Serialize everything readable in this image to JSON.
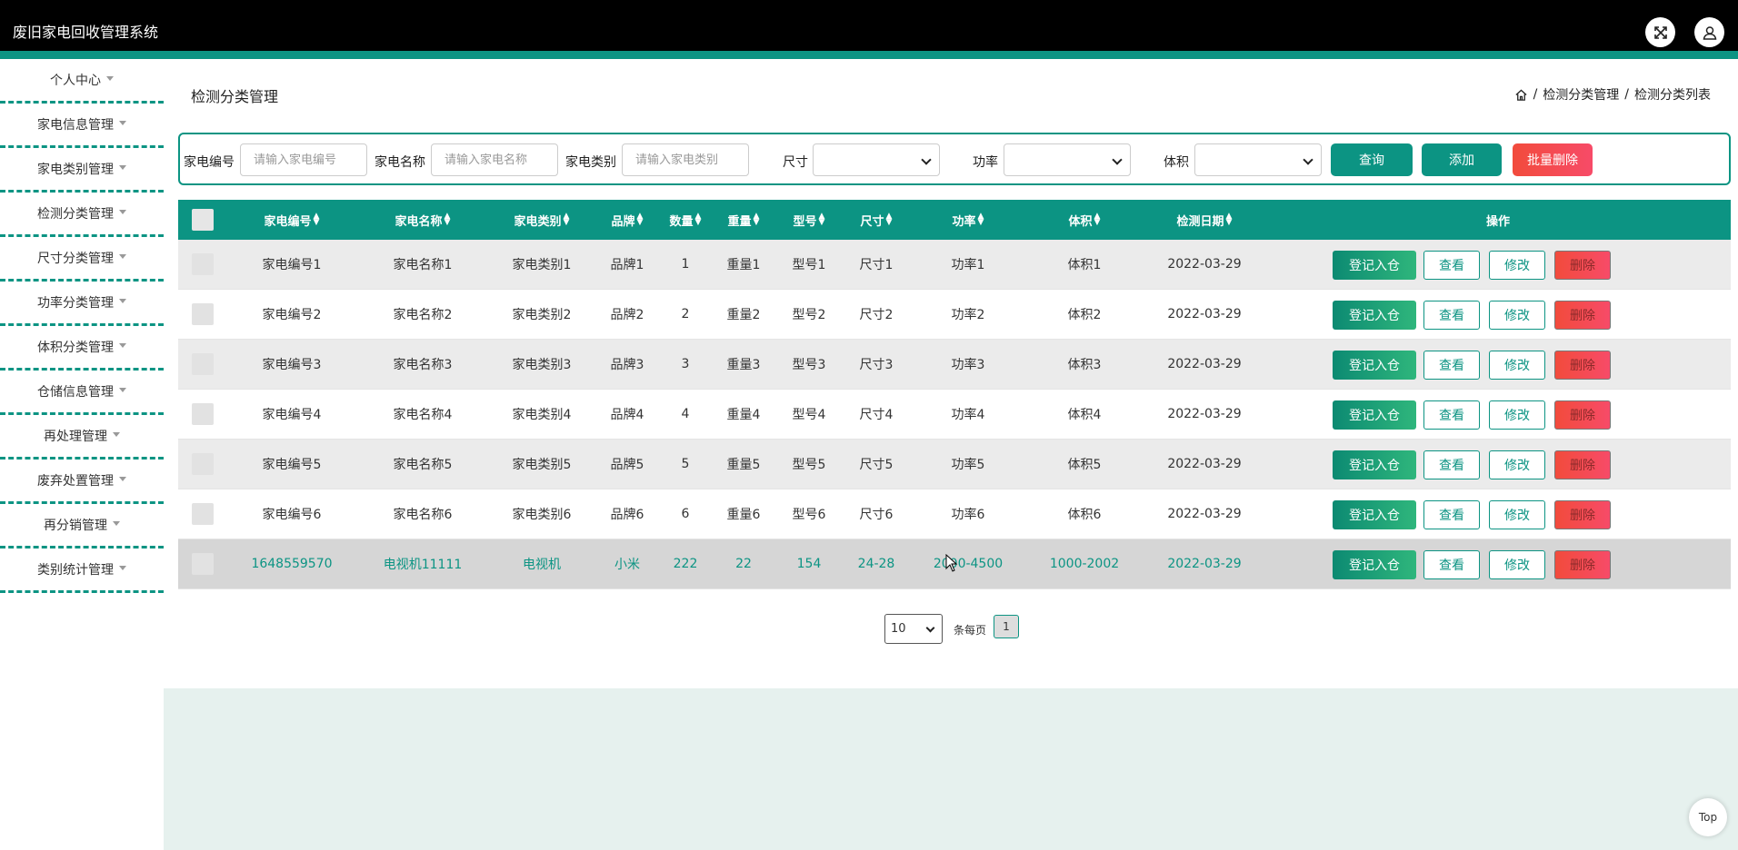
{
  "app": {
    "title": "废旧家电回收管理系统"
  },
  "sidebar": {
    "items": [
      {
        "label": "个人中心"
      },
      {
        "label": "家电信息管理"
      },
      {
        "label": "家电类别管理"
      },
      {
        "label": "检测分类管理"
      },
      {
        "label": "尺寸分类管理"
      },
      {
        "label": "功率分类管理"
      },
      {
        "label": "体积分类管理"
      },
      {
        "label": "仓储信息管理"
      },
      {
        "label": "再处理管理"
      },
      {
        "label": "废弃处置管理"
      },
      {
        "label": "再分销管理"
      },
      {
        "label": "类别统计管理"
      }
    ]
  },
  "page": {
    "title": "检测分类管理"
  },
  "breadcrumb": {
    "sep": "/",
    "level1": "检测分类管理",
    "level2": "检测分类列表"
  },
  "search": {
    "code_label": "家电编号",
    "code_placeholder": "请输入家电编号",
    "name_label": "家电名称",
    "name_placeholder": "请输入家电名称",
    "cat_label": "家电类别",
    "cat_placeholder": "请输入家电类别",
    "size_label": "尺寸",
    "power_label": "功率",
    "volume_label": "体积",
    "query_btn": "查询",
    "add_btn": "添加",
    "batch_del_btn": "批量删除"
  },
  "table": {
    "headers": [
      "家电编号",
      "家电名称",
      "家电类别",
      "品牌",
      "数量",
      "重量",
      "型号",
      "尺寸",
      "功率",
      "体积",
      "检测日期",
      "操作"
    ],
    "actions": {
      "checkin": "登记入仓",
      "view": "查看",
      "edit": "修改",
      "delete": "删除"
    },
    "rows": [
      [
        "家电编号1",
        "家电名称1",
        "家电类别1",
        "品牌1",
        "1",
        "重量1",
        "型号1",
        "尺寸1",
        "功率1",
        "体积1",
        "2022-03-29"
      ],
      [
        "家电编号2",
        "家电名称2",
        "家电类别2",
        "品牌2",
        "2",
        "重量2",
        "型号2",
        "尺寸2",
        "功率2",
        "体积2",
        "2022-03-29"
      ],
      [
        "家电编号3",
        "家电名称3",
        "家电类别3",
        "品牌3",
        "3",
        "重量3",
        "型号3",
        "尺寸3",
        "功率3",
        "体积3",
        "2022-03-29"
      ],
      [
        "家电编号4",
        "家电名称4",
        "家电类别4",
        "品牌4",
        "4",
        "重量4",
        "型号4",
        "尺寸4",
        "功率4",
        "体积4",
        "2022-03-29"
      ],
      [
        "家电编号5",
        "家电名称5",
        "家电类别5",
        "品牌5",
        "5",
        "重量5",
        "型号5",
        "尺寸5",
        "功率5",
        "体积5",
        "2022-03-29"
      ],
      [
        "家电编号6",
        "家电名称6",
        "家电类别6",
        "品牌6",
        "6",
        "重量6",
        "型号6",
        "尺寸6",
        "功率6",
        "体积6",
        "2022-03-29"
      ],
      [
        "1648559570",
        "电视机11111",
        "电视机",
        "小米",
        "222",
        "22",
        "154",
        "24-28",
        "2000-4500",
        "1000-2002",
        "2022-03-29"
      ]
    ]
  },
  "pagination": {
    "page_size": "10",
    "per_page_label": "条每页",
    "current_page": "1"
  },
  "top_button": "Top",
  "colors": {
    "accent": "#0c9483",
    "danger": "#f24b3c",
    "topbar": "#000000"
  },
  "icons": {
    "fullscreen": "fullscreen-icon",
    "user": "user-icon",
    "home": "home-icon"
  }
}
